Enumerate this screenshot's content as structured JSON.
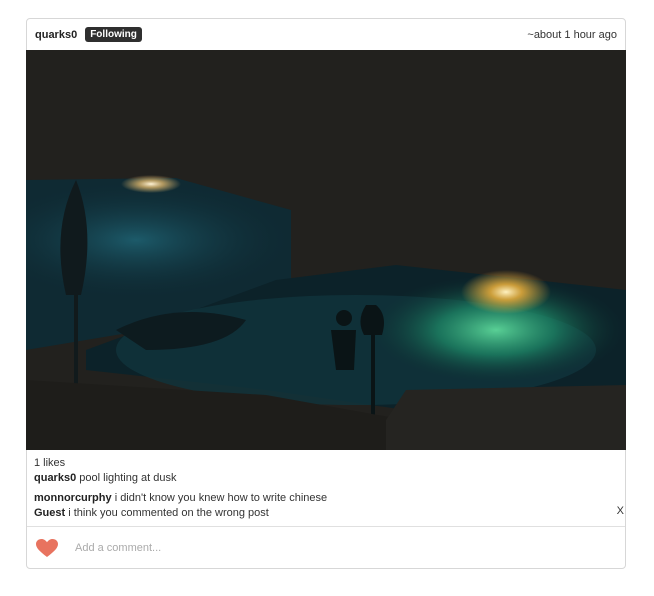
{
  "post": {
    "author": "quarks0",
    "follow_status": "Following",
    "timestamp": "~about 1 hour ago",
    "image_alt": "Night swimming pool with glowing underwater lights",
    "likes": "1 likes",
    "caption_author": "quarks0",
    "caption": "pool lighting at dusk"
  },
  "comments": [
    {
      "author": "monnorcurphy",
      "text": "i didn't know you knew how to write chinese"
    },
    {
      "author": "Guest",
      "text": "i think you commented on the wrong post"
    }
  ],
  "delete_comment_label": "X",
  "composer": {
    "placeholder": "Add a comment...",
    "like_icon": "heart-icon",
    "like_color": "#e8735f"
  }
}
